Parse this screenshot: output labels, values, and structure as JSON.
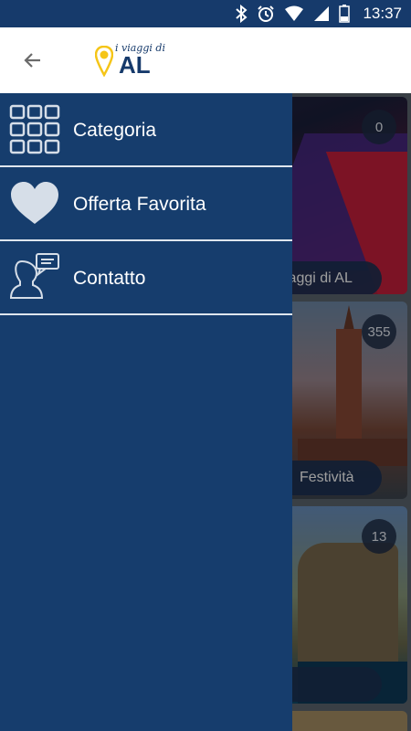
{
  "status_bar": {
    "time": "13:37",
    "icons": [
      "bluetooth-icon",
      "alarm-icon",
      "wifi-icon",
      "signal-icon",
      "battery-icon"
    ]
  },
  "app_bar": {
    "back_icon": "arrow-left-icon",
    "logo": {
      "small_text": "i viaggi di",
      "big_text": "AL",
      "icon": "map-pin-icon"
    }
  },
  "drawer": {
    "items": [
      {
        "label": "Categoria",
        "icon": "grid-icon"
      },
      {
        "label": "Offerta Favorita",
        "icon": "heart-icon"
      },
      {
        "label": "Contatto",
        "icon": "contact-chat-icon"
      }
    ]
  },
  "cards": [
    {
      "count": "0",
      "title": "i viaggi di AL"
    },
    {
      "count": "355",
      "title": "Festività"
    },
    {
      "count": "13",
      "title": ""
    }
  ],
  "colors": {
    "primary": "#163d6d",
    "status_bar": "#163a6b",
    "logo_pin": "#f5c518",
    "drawer_divider": "#dfe6ee",
    "icon_fill": "#d6dee8"
  }
}
